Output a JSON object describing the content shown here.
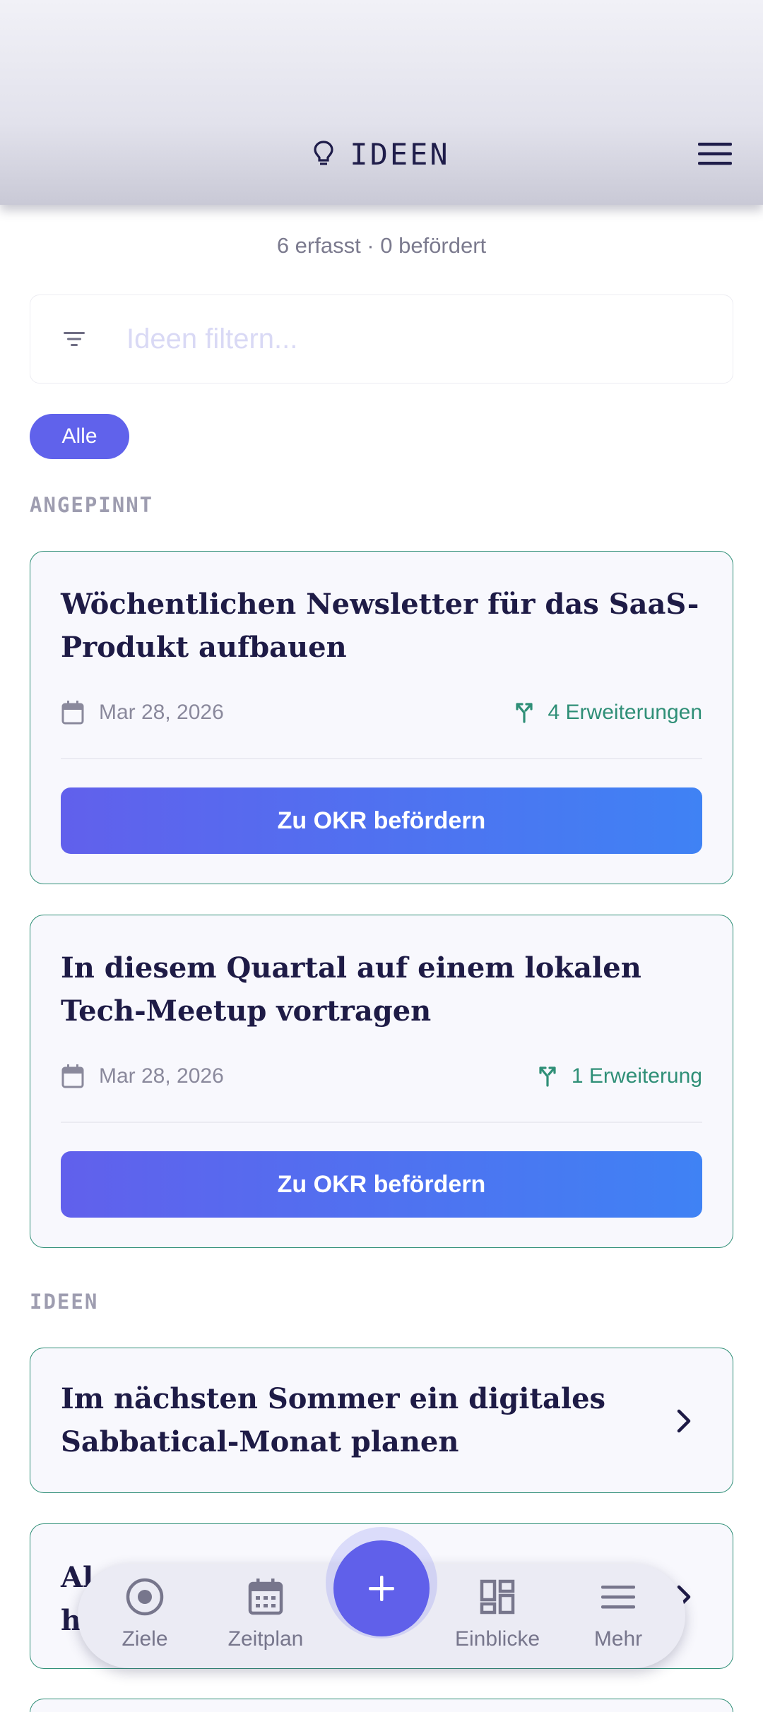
{
  "header": {
    "title": "IDEEN",
    "title_icon": "lightbulb-icon",
    "menu_icon": "menu-icon"
  },
  "summary": "6 erfasst · 0 befördert",
  "filter": {
    "placeholder": "Ideen filtern...",
    "icon": "filter-icon"
  },
  "chips": [
    {
      "label": "Alle",
      "active": true
    }
  ],
  "sections": {
    "pinned": "ANGEPINNT",
    "ideas": "IDEEN"
  },
  "pinned_cards": [
    {
      "title": "Wöchentlichen Newsletter für das SaaS-Produkt aufbauen",
      "date": "Mar 28, 2026",
      "extensions": "4 Erweiterungen",
      "button": "Zu OKR befördern"
    },
    {
      "title": "In diesem Quartal auf einem lokalen Tech-Meetup vortragen",
      "date": "Mar 28, 2026",
      "extensions": "1 Erweiterung",
      "button": "Zu OKR befördern"
    }
  ],
  "idea_cards": [
    {
      "title": "Im nächsten Sommer ein digitales Sabbatical-Monat planen"
    },
    {
      "title_partial_line1": "Al",
      "title_partial_line2": "h"
    }
  ],
  "bottom_nav": [
    {
      "label": "Ziele",
      "icon": "target-icon"
    },
    {
      "label": "Zeitplan",
      "icon": "calendar-icon"
    },
    {
      "label": "Einblicke",
      "icon": "dashboard-icon"
    },
    {
      "label": "Mehr",
      "icon": "menu-icon"
    }
  ],
  "fab": {
    "symbol": "+",
    "icon": "plus-icon"
  },
  "colors": {
    "accent": "#6062eb",
    "teal": "#2f8f77",
    "gradient_end": "#3f82f4"
  }
}
